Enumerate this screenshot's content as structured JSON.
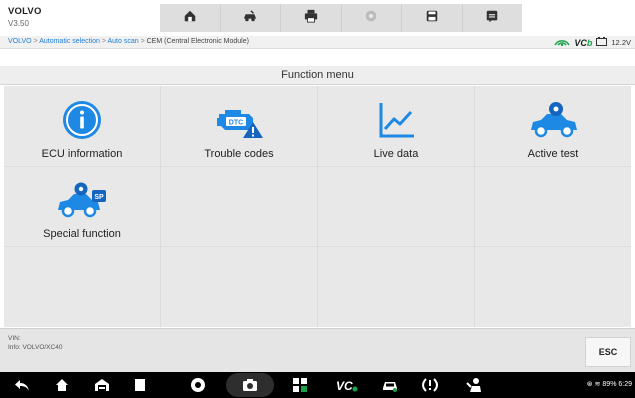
{
  "app": {
    "brand": "VOLVO",
    "version": "V3.50"
  },
  "toolbar": {
    "buttons": [
      "home-icon",
      "vehicle-service-icon",
      "printer-icon",
      "settings-icon",
      "save-icon",
      "data-logging-icon"
    ]
  },
  "breadcrumb": {
    "path": [
      "VOLVO",
      "Automatic selection",
      "Auto scan"
    ],
    "separator": " > ",
    "current": "CEM (Central Electronic Module)"
  },
  "status": {
    "vci_label": "VC",
    "vci_suffix": "b",
    "battery_voltage": "12.2V"
  },
  "menu": {
    "title": "Function menu",
    "items": [
      {
        "label": "ECU information",
        "icon": "info-icon"
      },
      {
        "label": "Trouble codes",
        "icon": "dtc-engine-icon"
      },
      {
        "label": "Live data",
        "icon": "live-data-chart-icon"
      },
      {
        "label": "Active test",
        "icon": "active-test-car-icon"
      },
      {
        "label": "Special function",
        "icon": "special-function-car-icon"
      }
    ]
  },
  "info": {
    "vin_label": "VIN:",
    "info_line": "Info: VOLVO/XC40"
  },
  "actions": {
    "esc_label": "ESC"
  },
  "system": {
    "status_text": "89%  6:29",
    "nav_icons": [
      "back-icon",
      "home-icon",
      "garage-icon",
      "recents-icon",
      "chrome-icon",
      "camera-icon",
      "color-icon",
      "vci-icon",
      "car-service-icon",
      "tpms-icon",
      "technician-icon"
    ]
  },
  "colors": {
    "accent_blue": "#1e7ed6",
    "grid_bg": "#e8e8e8",
    "vci_green": "#1aa34a"
  }
}
